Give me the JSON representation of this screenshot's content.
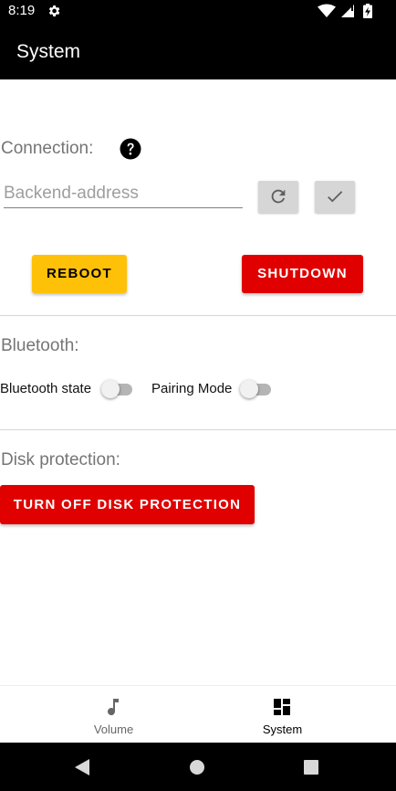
{
  "status_bar": {
    "time": "8:19",
    "left_icons": [
      "gear-icon"
    ],
    "right_icons": [
      "wifi-icon",
      "signal-icon",
      "battery-charging-icon"
    ]
  },
  "app_bar": {
    "title": "System"
  },
  "connection": {
    "label": "Connection:",
    "help_icon": "help-circle-icon",
    "backend_input": {
      "placeholder": "Backend-address",
      "value": ""
    },
    "refresh_icon": "refresh-icon",
    "confirm_icon": "check-icon",
    "reboot_label": "REBOOT",
    "shutdown_label": "SHUTDOWN"
  },
  "bluetooth": {
    "label": "Bluetooth:",
    "state_label": "Bluetooth state",
    "state_on": false,
    "pairing_label": "Pairing Mode",
    "pairing_on": false
  },
  "disk": {
    "label": "Disk protection:",
    "button_label": "TURN OFF DISK PROTECTION"
  },
  "bottom_nav": {
    "items": [
      {
        "label": "Volume",
        "icon": "music-note-icon",
        "selected": false
      },
      {
        "label": "System",
        "icon": "dashboard-icon",
        "selected": true
      }
    ]
  },
  "system_nav": {
    "icons": [
      "back-icon",
      "home-icon",
      "recents-icon"
    ]
  },
  "colors": {
    "app_bar": "#000000",
    "reboot": "#FFC107",
    "danger": "#E00000",
    "icon_button": "#D6D6D6",
    "section_label": "#757575"
  }
}
